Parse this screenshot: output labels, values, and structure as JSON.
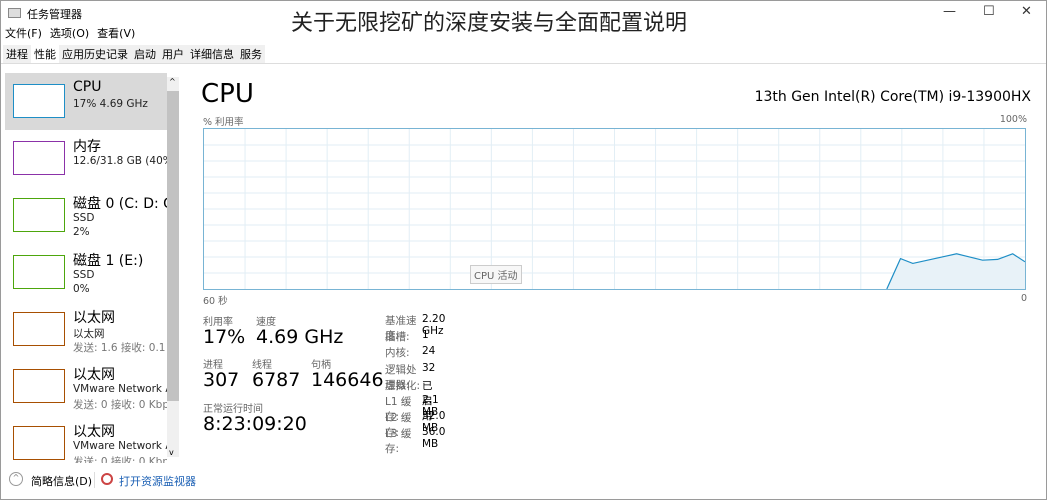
{
  "window": {
    "title": "任务管理器",
    "caption": "关于无限挖矿的深度安装与全面配置说明",
    "controls": [
      "minimize",
      "maximize",
      "close"
    ]
  },
  "menu": [
    "文件(F)",
    "选项(O)",
    "查看(V)"
  ],
  "tabs": [
    {
      "label": "进程"
    },
    {
      "label": "性能",
      "active": true
    },
    {
      "label": "应用历史记录"
    },
    {
      "label": "启动"
    },
    {
      "label": "用户"
    },
    {
      "label": "详细信息"
    },
    {
      "label": "服务"
    }
  ],
  "sidebar": [
    {
      "name": "CPU",
      "line1": "17% 4.69 GHz",
      "line2": "",
      "color": "#1e8ec6",
      "active": true
    },
    {
      "name": "内存",
      "line1": "12.6/31.8 GB (40%)",
      "line2": "",
      "color": "#8b32a8"
    },
    {
      "name": "磁盘 0 (C: D: G",
      "line1": "SSD",
      "line2": "2%",
      "color": "#4da60c"
    },
    {
      "name": "磁盘 1 (E:)",
      "line1": "SSD",
      "line2": "0%",
      "color": "#4da60c"
    },
    {
      "name": "以太网",
      "line1": "以太网",
      "line2": "发送: 1.6 接收: 0.1 I",
      "color": "#a74f01"
    },
    {
      "name": "以太网",
      "line1": "VMware Network A",
      "line2": "发送: 0 接收: 0 Kbp",
      "color": "#a74f01"
    },
    {
      "name": "以太网",
      "line1": "VMware Network A",
      "line2": "发送: 0 接收: 0 Kbp",
      "color": "#a74f01"
    }
  ],
  "main": {
    "title": "CPU",
    "model": "13th Gen Intel(R) Core(TM) i9-13900HX",
    "tooltip": "CPU 活动"
  },
  "chart_data": {
    "type": "area",
    "ylabel": "% 利用率",
    "ymax_label": "100%",
    "xleft_label": "60 秒",
    "xright_label": "0",
    "xlim": [
      60,
      0
    ],
    "ylim": [
      0,
      100
    ],
    "grid": true,
    "color": "#1e8ec6",
    "x": [
      10.1,
      9.1,
      8.2,
      5.0,
      3.1,
      2.0,
      0.9,
      0
    ],
    "values": [
      0,
      19,
      16,
      22,
      18,
      18.5,
      22,
      17
    ]
  },
  "stats": {
    "util_label": "利用率",
    "util": "17%",
    "speed_label": "速度",
    "speed": "4.69 GHz",
    "proc_label": "进程",
    "proc": "307",
    "threads_label": "线程",
    "threads": "6787",
    "handles_label": "句柄",
    "handles": "146646",
    "uptime_label": "正常运行时间",
    "uptime": "8:23:09:20"
  },
  "specs": [
    {
      "k": "基准速度:",
      "v": "2.20 GHz"
    },
    {
      "k": "插槽:",
      "v": "1"
    },
    {
      "k": "内核:",
      "v": "24"
    },
    {
      "k": "逻辑处理器:",
      "v": "32"
    },
    {
      "k": "虚拟化:",
      "v": "已启用"
    },
    {
      "k": "L1 缓存:",
      "v": "2.1 MB"
    },
    {
      "k": "L2 缓存:",
      "v": "32.0 MB"
    },
    {
      "k": "L3 缓存:",
      "v": "36.0 MB"
    }
  ],
  "footer": {
    "brief": "简略信息(D)",
    "monitor": "打开资源监视器"
  }
}
